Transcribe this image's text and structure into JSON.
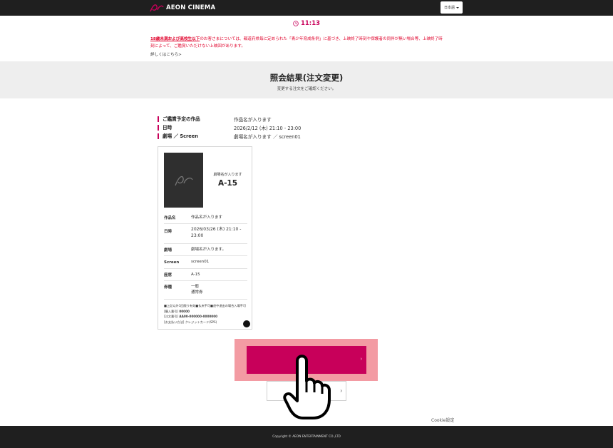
{
  "header": {
    "logo_text": "AEON CINEMA",
    "language": "日本語"
  },
  "timer": "11:13",
  "notice": {
    "highlight": "18歳未満および高校生以下",
    "text": "のお客さまについては、都道府県毎に定められた「青少年育成条例」に基づき、上映終了時刻や保護者の同伴が無い場合等、上映終了時",
    "text2": "刻によって、ご鑑賞いただけない上映回があります。",
    "link": "詳しくはこちら>"
  },
  "band": {
    "title": "照会結果(注文変更)",
    "subtitle": "変更する注文をご確認ください。"
  },
  "info": [
    {
      "key": "ご鑑賞予定の作品",
      "value": "作品名が入ります"
    },
    {
      "key": "日時",
      "value": "2026/2/12 (木) 21:10 - 23:00"
    },
    {
      "key": "劇場 ／ Screen",
      "value": "劇場名が入ります ／ screen01"
    }
  ],
  "ticket": {
    "theater": "劇場名が入ります",
    "seat": "A-15",
    "rows": [
      {
        "key": "作品名",
        "value": "作品名が入ります"
      },
      {
        "key": "日時",
        "value": "2026/03/26 (木) 21:10 - 23:00"
      },
      {
        "key": "劇場",
        "value": "劇場名が入ります。"
      },
      {
        "key": "Screen",
        "value": "screen01"
      },
      {
        "key": "座席",
        "value": "A-15"
      },
      {
        "key": "券種",
        "value": "一般\n通常券"
      }
    ],
    "foot1": "■上記以外1回限り有効■払戻不可■途中退出の場合入場不可",
    "foot2_label": "[購入番号] ",
    "foot2_value": "00000",
    "foot3_label": "[注文番号] ",
    "foot3_value": "AA00-000000-0000000",
    "foot4": "[お支払い方法] クレジットカード(SPS)"
  },
  "cookie": "Cookie設定",
  "footer": {
    "copyright": "Copyright © AEON ENTERTAINMENT CO.,LTD"
  },
  "colors": {
    "accent": "#c8005a",
    "highlight": "#f39ba3",
    "header_bg": "#1f1f1f",
    "band_bg": "#eeeeee"
  }
}
